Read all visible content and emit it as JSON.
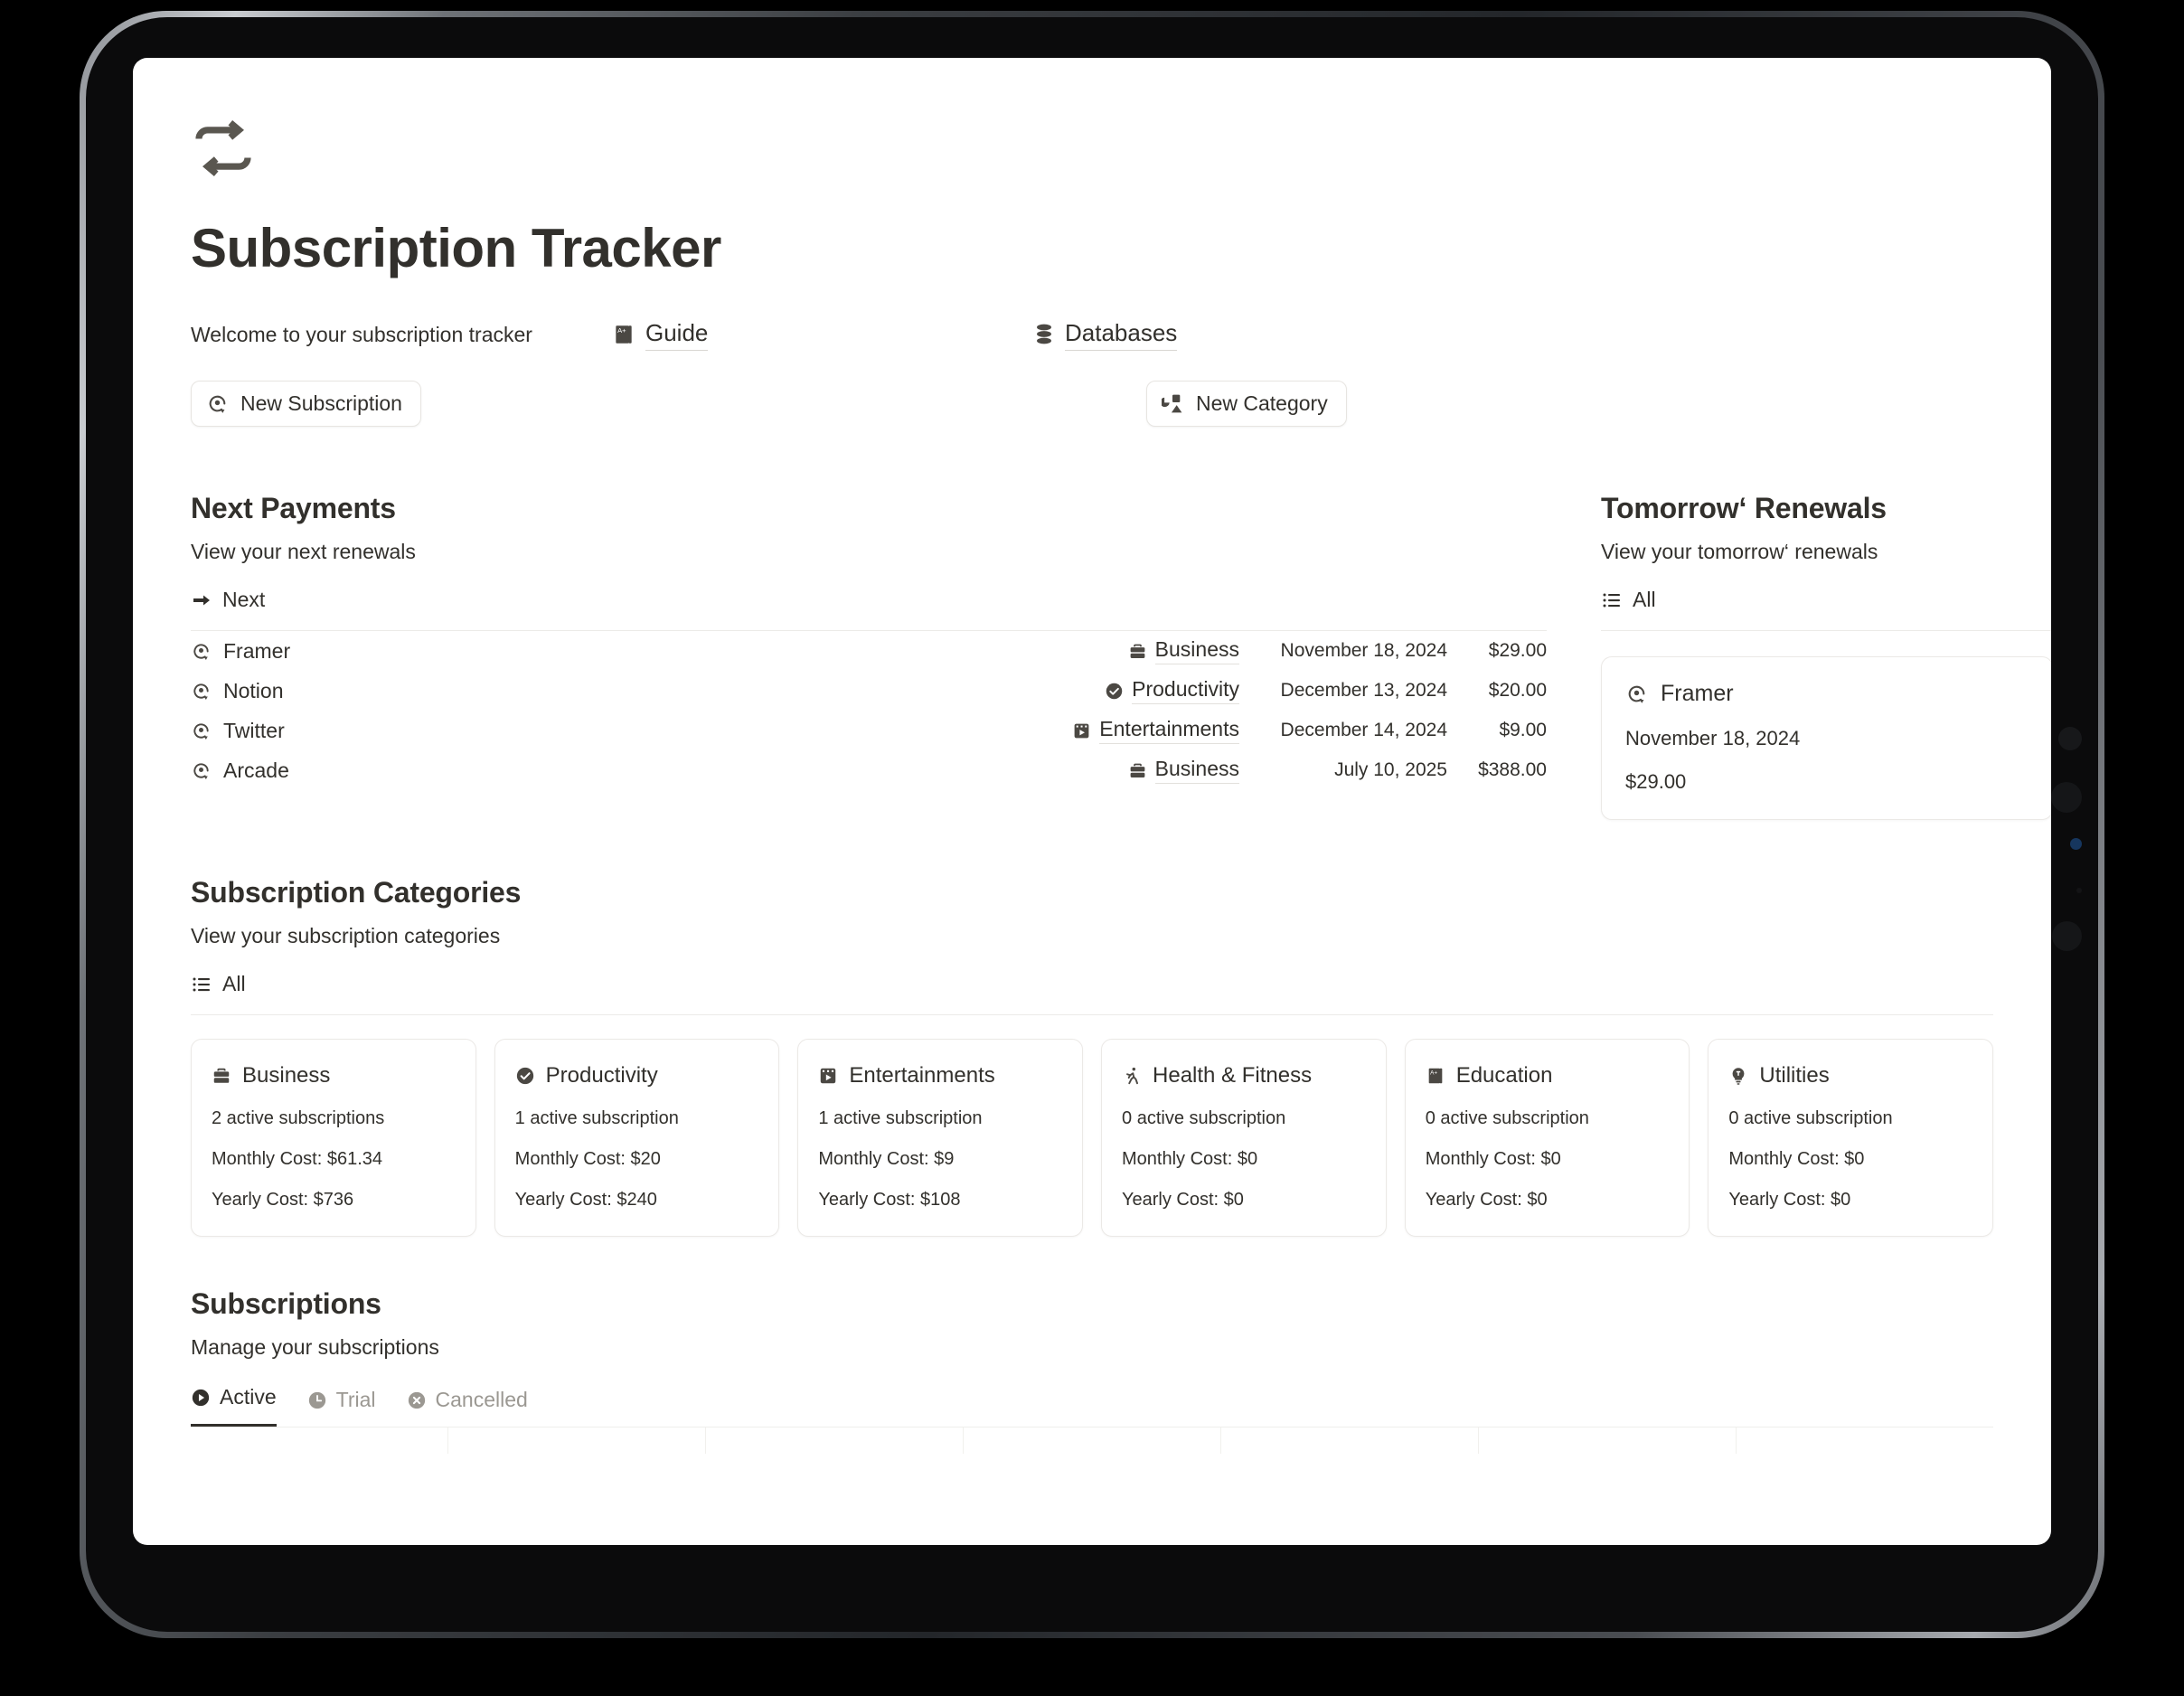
{
  "header": {
    "logo_icon": "repeat-loop-icon",
    "title": "Subscription Tracker",
    "welcome": "Welcome to your subscription tracker",
    "guide_label": "Guide",
    "guide_icon": "book-icon",
    "databases_label": "Databases",
    "databases_icon": "database-stack-icon",
    "new_subscription_label": "New Subscription",
    "new_subscription_icon": "subscription-refresh-icon",
    "new_category_label": "New Category",
    "new_category_icon": "shapes-icon"
  },
  "next_payments": {
    "title": "Next Payments",
    "subtitle": "View your next renewals",
    "view_label": "Next",
    "view_icon": "arrow-right-icon",
    "rows": [
      {
        "name": "Framer",
        "name_icon": "subscription-refresh-icon",
        "category": "Business",
        "category_icon": "briefcase-icon",
        "date": "November 18, 2024",
        "amount": "$29.00"
      },
      {
        "name": "Notion",
        "name_icon": "subscription-refresh-icon",
        "category": "Productivity",
        "category_icon": "check-circle-icon",
        "date": "December 13, 2024",
        "amount": "$20.00"
      },
      {
        "name": "Twitter",
        "name_icon": "subscription-refresh-icon",
        "category": "Entertainments",
        "category_icon": "film-icon",
        "date": "December 14, 2024",
        "amount": "$9.00"
      },
      {
        "name": "Arcade",
        "name_icon": "subscription-refresh-icon",
        "category": "Business",
        "category_icon": "briefcase-icon",
        "date": "July 10, 2025",
        "amount": "$388.00"
      }
    ]
  },
  "tomorrow_renewals": {
    "title": "Tomorrow‘ Renewals",
    "subtitle": "View your tomorrow‘ renewals",
    "view_label": "All",
    "view_icon": "list-icon",
    "card": {
      "name": "Framer",
      "name_icon": "subscription-refresh-icon",
      "date": "November 18, 2024",
      "amount": "$29.00"
    }
  },
  "subscription_categories": {
    "title": "Subscription Categories",
    "subtitle": "View your subscription categories",
    "view_label": "All",
    "view_icon": "list-icon",
    "cards": [
      {
        "name": "Business",
        "icon": "briefcase-icon",
        "active": "2 active subscriptions",
        "monthly": "Monthly Cost: $61.34",
        "yearly": "Yearly Cost: $736"
      },
      {
        "name": "Productivity",
        "icon": "check-circle-icon",
        "active": "1 active subscription",
        "monthly": "Monthly Cost: $20",
        "yearly": "Yearly Cost: $240"
      },
      {
        "name": "Entertainments",
        "icon": "film-icon",
        "active": "1 active subscription",
        "monthly": "Monthly Cost: $9",
        "yearly": "Yearly Cost: $108"
      },
      {
        "name": "Health & Fitness",
        "icon": "running-icon",
        "active": "0 active subscription",
        "monthly": "Monthly Cost: $0",
        "yearly": "Yearly Cost: $0"
      },
      {
        "name": "Education",
        "icon": "book-icon",
        "active": "0 active subscription",
        "monthly": "Monthly Cost: $0",
        "yearly": "Yearly Cost: $0"
      },
      {
        "name": "Utilities",
        "icon": "lightbulb-icon",
        "active": "0 active subscription",
        "monthly": "Monthly Cost: $0",
        "yearly": "Yearly Cost: $0"
      }
    ]
  },
  "subscriptions": {
    "title": "Subscriptions",
    "subtitle": "Manage your subscriptions",
    "tabs": [
      {
        "label": "Active",
        "icon": "play-circle-icon",
        "selected": true
      },
      {
        "label": "Trial",
        "icon": "clock-icon",
        "selected": false
      },
      {
        "label": "Cancelled",
        "icon": "x-circle-icon",
        "selected": false
      }
    ]
  },
  "colors": {
    "text": "#32302c",
    "muted": "#9b9892",
    "border": "#ebe9e6",
    "divider": "#ecebe8",
    "background": "#ffffff"
  }
}
